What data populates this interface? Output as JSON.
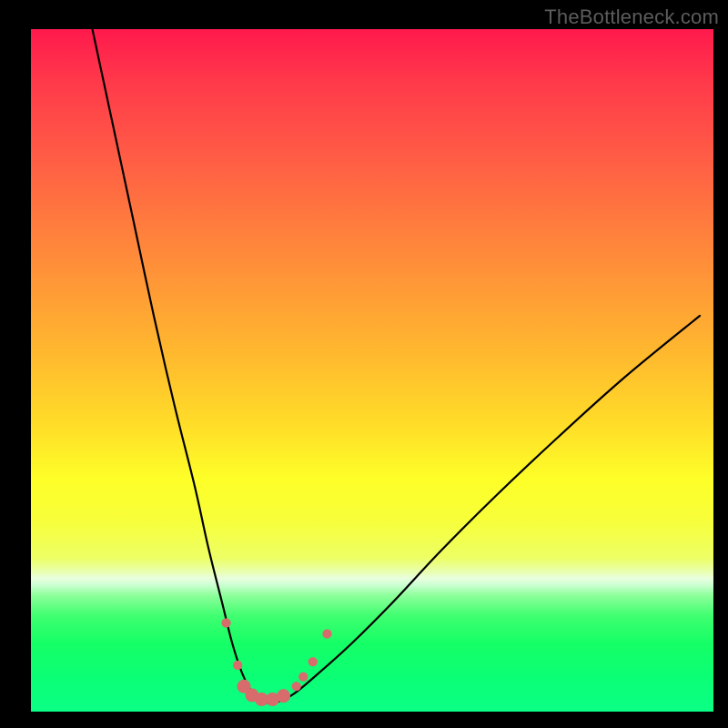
{
  "watermark": "TheBottleneck.com",
  "chart_data": {
    "type": "line",
    "title": "",
    "xlabel": "",
    "ylabel": "",
    "xlim": [
      0,
      100
    ],
    "ylim": [
      0,
      100
    ],
    "series": [
      {
        "name": "bottleneck-curve",
        "x": [
          9,
          12,
          15,
          18,
          21,
          24,
          26,
          28,
          29.5,
          31,
          32.5,
          34,
          36,
          38.5,
          42,
          47,
          53,
          60,
          68,
          77,
          87,
          98
        ],
        "y": [
          100,
          86,
          72,
          58,
          45,
          33,
          24,
          16,
          10,
          5.5,
          2.7,
          1.4,
          1.4,
          2.6,
          5.5,
          10,
          16,
          23.5,
          31.5,
          40,
          49,
          58
        ]
      }
    ],
    "markers": {
      "name": "highlight-dots",
      "color": "#d86b6b",
      "points": [
        {
          "x": 28.6,
          "y": 13.0,
          "r": 1.1
        },
        {
          "x": 30.3,
          "y": 6.8,
          "r": 1.1
        },
        {
          "x": 31.2,
          "y": 3.7,
          "r": 1.6
        },
        {
          "x": 32.4,
          "y": 2.4,
          "r": 1.6
        },
        {
          "x": 33.8,
          "y": 1.8,
          "r": 1.6
        },
        {
          "x": 35.4,
          "y": 1.8,
          "r": 1.6
        },
        {
          "x": 37.0,
          "y": 2.3,
          "r": 1.6
        },
        {
          "x": 38.9,
          "y": 3.7,
          "r": 1.1
        },
        {
          "x": 39.9,
          "y": 5.1,
          "r": 1.1
        },
        {
          "x": 41.3,
          "y": 7.3,
          "r": 1.1
        },
        {
          "x": 43.4,
          "y": 11.4,
          "r": 1.1
        }
      ]
    }
  }
}
